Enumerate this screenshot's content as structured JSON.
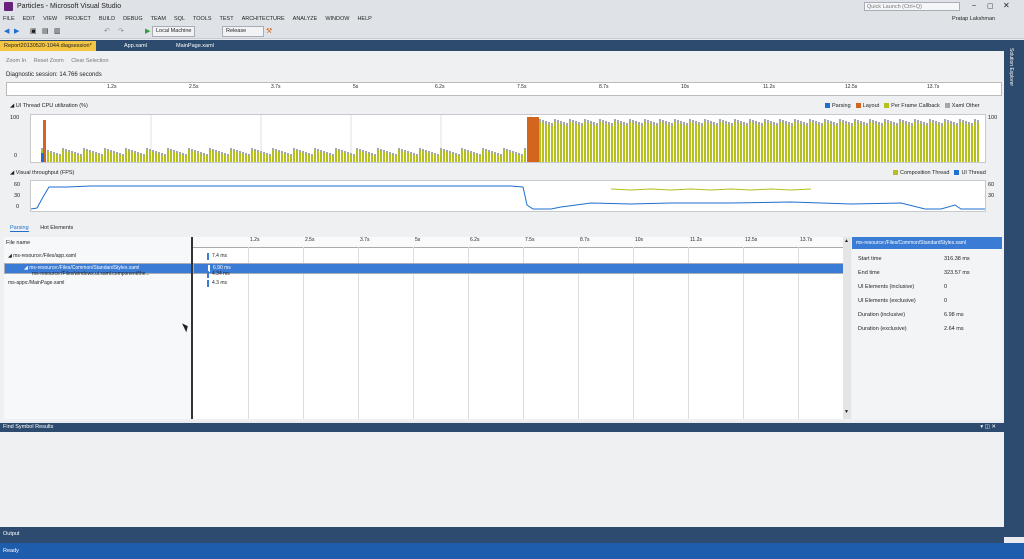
{
  "window": {
    "title": "Particles - Microsoft Visual Studio",
    "quick_launch": "Quick Launch (Ctrl+Q)",
    "user": "Pratap Lakshman"
  },
  "menu": [
    "FILE",
    "EDIT",
    "VIEW",
    "PROJECT",
    "BUILD",
    "DEBUG",
    "TEAM",
    "SQL",
    "TOOLS",
    "TEST",
    "ARCHITECTURE",
    "ANALYZE",
    "WINDOW",
    "HELP"
  ],
  "toolbar": {
    "target": "Local Machine",
    "config": "Release"
  },
  "tabs": [
    {
      "label": "Report20130520-1044.diagsession*",
      "active": true
    },
    {
      "label": "App.xaml",
      "active": false
    },
    {
      "label": "MainPage.xaml",
      "active": false
    }
  ],
  "right_strip_label": "Solution Explorer",
  "commands": {
    "zoom_in": "Zoom In",
    "reset_zoom": "Reset Zoom",
    "clear_selection": "Clear Selection"
  },
  "session": {
    "label": "Diagnostic session: 14.766 seconds"
  },
  "ruler_ticks": [
    "1.2s",
    "2.5s",
    "3.7s",
    "5s",
    "6.2s",
    "7.5s",
    "8.7s",
    "10s",
    "11.2s",
    "12.5s",
    "13.7s"
  ],
  "cpu_graph": {
    "title": "UI Thread CPU utilization (%)",
    "y_top": "100",
    "y_bottom": "0",
    "y_right": "100",
    "legend": [
      {
        "label": "Parsing",
        "color": "#1e6fcf"
      },
      {
        "label": "Layout",
        "color": "#d3661f"
      },
      {
        "label": "Per Frame Callback",
        "color": "#b5bf1e"
      },
      {
        "label": "Xaml Other",
        "color": "#a3a8ad"
      }
    ]
  },
  "fps_graph": {
    "title": "Visual throughput (FPS)",
    "y_ticks": [
      "60",
      "30",
      "0"
    ],
    "y_right_ticks": [
      "60",
      "30"
    ],
    "legend": [
      {
        "label": "Composition Thread",
        "color": "#b5bf1e"
      },
      {
        "label": "UI Thread",
        "color": "#1e6fcf"
      }
    ]
  },
  "lower_tabs": [
    "Parsing",
    "Hot Elements"
  ],
  "tree": {
    "header": "File name",
    "rows": [
      {
        "label": "◢ ms-resource:/Files/app.xaml",
        "indent": 0,
        "selected": false
      },
      {
        "label": "◢ ms-resource:/Files/Common/StandardStyles.xaml",
        "indent": 1,
        "selected": true
      },
      {
        "label": "ms-resource:/Files/windows.ui.xaml.component/the...",
        "indent": 2,
        "selected": false
      },
      {
        "label": "ms-appx:/MainPage.xaml",
        "indent": 0,
        "selected": false
      }
    ]
  },
  "timeline": {
    "ticks": [
      "1.2s",
      "2.5s",
      "3.7s",
      "5s",
      "6.2s",
      "7.5s",
      "8.7s",
      "10s",
      "11.2s",
      "12.5s",
      "13.7s"
    ],
    "rows": [
      {
        "value": "7.4 ms",
        "selected": false
      },
      {
        "value": "6.90 ms",
        "selected": true
      },
      {
        "value": "4.34 ms",
        "selected": false
      },
      {
        "value": "4.3 ms",
        "selected": false
      }
    ]
  },
  "details": {
    "header": "ms-resource:/Files/Common/StandardStyles.xaml",
    "rows": [
      {
        "label": "Start time",
        "value": "316.38 ms"
      },
      {
        "label": "End time",
        "value": "323.57 ms"
      },
      {
        "label": "UI Elements (inclusive)",
        "value": "0"
      },
      {
        "label": "UI Elements (exclusive)",
        "value": "0"
      },
      {
        "label": "Duration (inclusive)",
        "value": "6.98 ms"
      },
      {
        "label": "Duration (exclusive)",
        "value": "2.64 ms"
      }
    ]
  },
  "find_panel": {
    "title": "Find Symbol Results"
  },
  "output_panel": {
    "title": "Output"
  },
  "status": {
    "text": "Ready"
  }
}
